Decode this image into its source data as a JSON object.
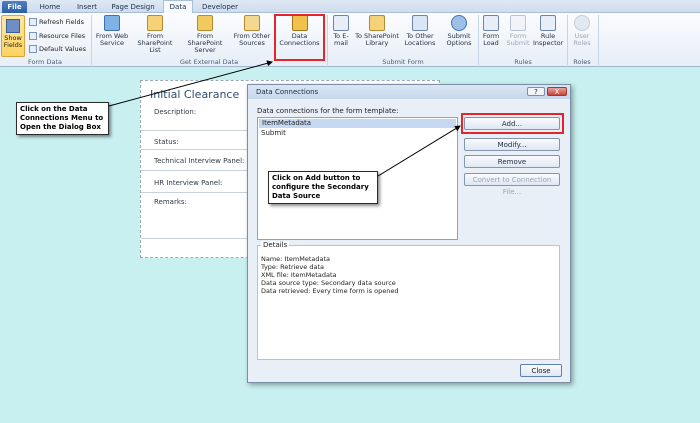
{
  "tabs": [
    {
      "label": "File"
    },
    {
      "label": "Home"
    },
    {
      "label": "Insert"
    },
    {
      "label": "Page Design"
    },
    {
      "label": "Data"
    },
    {
      "label": "Developer"
    }
  ],
  "ribbon": {
    "form_data": {
      "show_fields": "Show Fields",
      "refresh_fields": "Refresh Fields",
      "resource_files": "Resource Files",
      "default_values": "Default Values",
      "label": "Form Data"
    },
    "get_external": {
      "from_web_service": "From Web Service",
      "from_sharepoint_list": "From SharePoint List",
      "from_sharepoint_server": "From SharePoint Server",
      "from_other_sources": "From Other Sources",
      "data_connections": "Data Connections",
      "label": "Get External Data"
    },
    "submit_form": {
      "to_email": "To E-mail",
      "to_sharepoint_library": "To SharePoint Library",
      "to_other_locations": "To Other Locations",
      "submit_options": "Submit Options",
      "label": "Submit Form"
    },
    "rules": {
      "form_load": "Form Load",
      "form_submit": "Form Submit",
      "rule_inspector": "Rule Inspector",
      "label": "Rules"
    },
    "roles": {
      "user_roles": "User Roles",
      "label": "Roles"
    }
  },
  "form": {
    "title": "Initial Clearance",
    "fields": [
      "Description:",
      "Status:",
      "Technical Interview Panel:",
      "HR Interview Panel:",
      "Remarks:"
    ]
  },
  "dialog": {
    "title": "Data Connections",
    "help": "?",
    "close_glyph": "X",
    "list_label": "Data connections for the form template:",
    "connections": [
      "ItemMetadata",
      "Submit"
    ],
    "buttons": {
      "add": "Add...",
      "modify": "Modify...",
      "remove": "Remove",
      "convert": "Convert to Connection File..."
    },
    "details_caption": "Details",
    "details": [
      "Name: ItemMetadata",
      "Type: Retrieve data",
      "XML file: ItemMetadata",
      "Data source type: Secondary data source",
      "Data retrieved: Every time form is opened"
    ],
    "close_button": "Close"
  },
  "callouts": {
    "data_connections": "Click on the Data Connections Menu to Open the Dialog Box",
    "add_button": "Click on Add button to configure the Secondary Data Source"
  },
  "colors": {
    "highlight": "#e4262b",
    "background": "#c9f0f1",
    "file_tab": "#2a5ea8"
  }
}
